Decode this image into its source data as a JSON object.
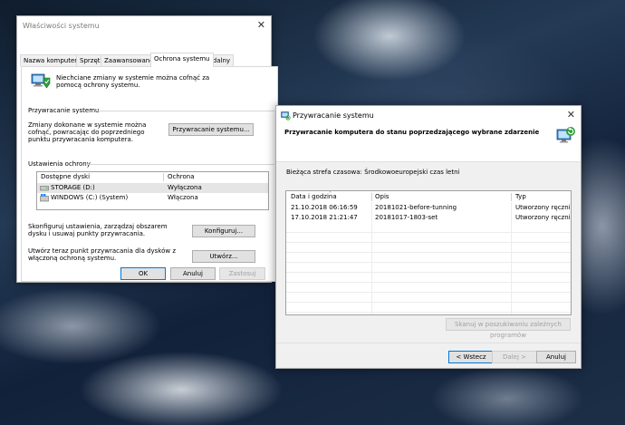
{
  "sysprops": {
    "title": "Właściwości systemu",
    "tabs": [
      "Nazwa komputera",
      "Sprzęt",
      "Zaawansowane",
      "Ochrona systemu",
      "Zdalny"
    ],
    "active_tab": "Ochrona systemu",
    "intro": "Niechciane zmiany w systemie można cofnąć za pomocą ochrony systemu.",
    "restore_section": "Przywracanie systemu",
    "restore_desc": "Zmiany dokonane w systemie można cofnąć, powracając do poprzedniego punktu przywracania komputera.",
    "restore_button": "Przywracanie systemu...",
    "protection_section": "Ustawienia ochrony",
    "drives_columns": [
      "Dostępne dyski",
      "Ochrona"
    ],
    "drives": [
      {
        "name": "STORAGE (D:)",
        "status": "Wyłączona",
        "selected": true
      },
      {
        "name": "WINDOWS (C:) (System)",
        "status": "Włączona",
        "selected": false
      }
    ],
    "configure_desc": "Skonfiguruj ustawienia, zarządzaj obszarem dysku i usuwaj punkty przywracania.",
    "configure_button": "Konfiguruj...",
    "create_desc": "Utwórz teraz punkt przywracania dla dysków z włączoną ochroną systemu.",
    "create_button": "Utwórz...",
    "ok_button": "OK",
    "cancel_button": "Anuluj",
    "apply_button": "Zastosuj"
  },
  "restore": {
    "title": "Przywracanie systemu",
    "heading": "Przywracanie komputera do stanu poprzedzającego wybrane zdarzenie",
    "timezone": "Bieżąca strefa czasowa: Środkowoeuropejski czas letni",
    "columns": [
      "Data i godzina",
      "Opis",
      "Typ"
    ],
    "points": [
      {
        "date": "21.10.2018 06:16:59",
        "desc": "20181021-before-tunning",
        "type": "Utworzony ręcznie"
      },
      {
        "date": "17.10.2018 21:21:47",
        "desc": "20181017-1803-set",
        "type": "Utworzony ręcznie"
      }
    ],
    "scan_button": "Skanuj w poszukiwaniu zależnych programów",
    "back_button": "< Wstecz",
    "next_button": "Dalej >",
    "cancel_button": "Anuluj"
  }
}
